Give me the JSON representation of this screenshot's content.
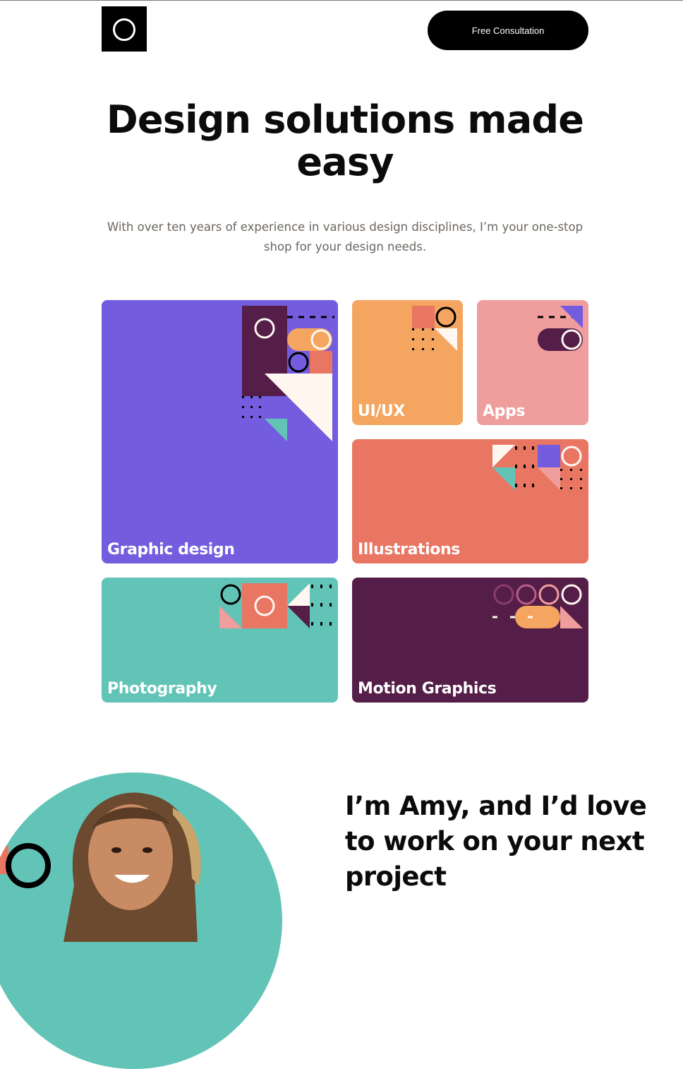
{
  "header": {
    "cta_label": "Free Consultation"
  },
  "hero": {
    "title": "Design solutions made easy",
    "subtitle": "With over ten years of experience in various design disciplines, I’m your one-stop shop for your design needs."
  },
  "services": [
    {
      "label": "Graphic design",
      "color": "#745cde"
    },
    {
      "label": "UI/UX",
      "color": "#f4a55f"
    },
    {
      "label": "Apps",
      "color": "#f09d9d"
    },
    {
      "label": "Illustrations",
      "color": "#e97563"
    },
    {
      "label": "Photography",
      "color": "#62c4b7"
    },
    {
      "label": "Motion Graphics",
      "color": "#541e48"
    }
  ],
  "about": {
    "title": "I’m Amy, and I’d love to work on your next project"
  },
  "colors": {
    "ink": "#0b0b0b",
    "purple": "#745cde",
    "orange": "#f4a55f",
    "pink": "#f09d9d",
    "coral": "#e97563",
    "teal": "#62c4b7",
    "plum": "#541e48",
    "cream": "#fff7f0"
  }
}
